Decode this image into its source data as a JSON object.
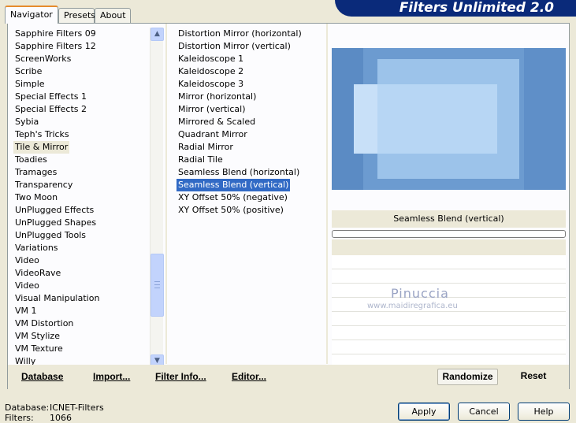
{
  "tabs": [
    {
      "label": "Navigator",
      "active": true
    },
    {
      "label": "Presets",
      "active": false
    },
    {
      "label": "About",
      "active": false
    }
  ],
  "title": "Filters Unlimited 2.0",
  "categories": {
    "items": [
      "Sapphire Filters 09",
      "Sapphire Filters 12",
      "ScreenWorks",
      "Scribe",
      "Simple",
      "Special Effects 1",
      "Special Effects 2",
      "Sybia",
      "Teph's Tricks",
      "Tile & Mirror",
      "Toadies",
      "Tramages",
      "Transparency",
      "Two Moon",
      "UnPlugged Effects",
      "UnPlugged Shapes",
      "UnPlugged Tools",
      "Variations",
      "Video",
      "VideoRave",
      "Video",
      "Visual Manipulation",
      "VM 1",
      "VM Distortion",
      "VM Stylize",
      "VM Texture",
      "Willy"
    ],
    "selected": "Tile & Mirror",
    "scroll_position": 0.85
  },
  "filters": {
    "items": [
      "Distortion Mirror (horizontal)",
      "Distortion Mirror (vertical)",
      "Kaleidoscope 1",
      "Kaleidoscope 2",
      "Kaleidoscope 3",
      "Mirror (horizontal)",
      "Mirror (vertical)",
      "Mirrored & Scaled",
      "Quadrant Mirror",
      "Radial Mirror",
      "Radial Tile",
      "Seamless Blend (horizontal)",
      "Seamless Blend (vertical)",
      "XY Offset 50% (negative)",
      "XY Offset 50% (positive)"
    ],
    "selected": "Seamless Blend (vertical)"
  },
  "preview": {
    "filter_name": "Seamless Blend (vertical)",
    "progress": 0
  },
  "watermark": {
    "line1": "Pinuccia",
    "line2": "www.maidiregrafica.eu"
  },
  "toolbar": {
    "database": "Database",
    "import": "Import...",
    "filter_info": "Filter Info...",
    "editor": "Editor...",
    "randomize": "Randomize",
    "reset": "Reset"
  },
  "footer": {
    "database_label": "Database:",
    "database_value": "ICNET-Filters",
    "filters_label": "Filters:",
    "filters_value": "1066",
    "apply": "Apply",
    "cancel": "Cancel",
    "help": "Help"
  },
  "colors": {
    "selection": "#316ac5",
    "title_banner": "#0a2a7a",
    "dialog_bg": "#ece9d8"
  }
}
